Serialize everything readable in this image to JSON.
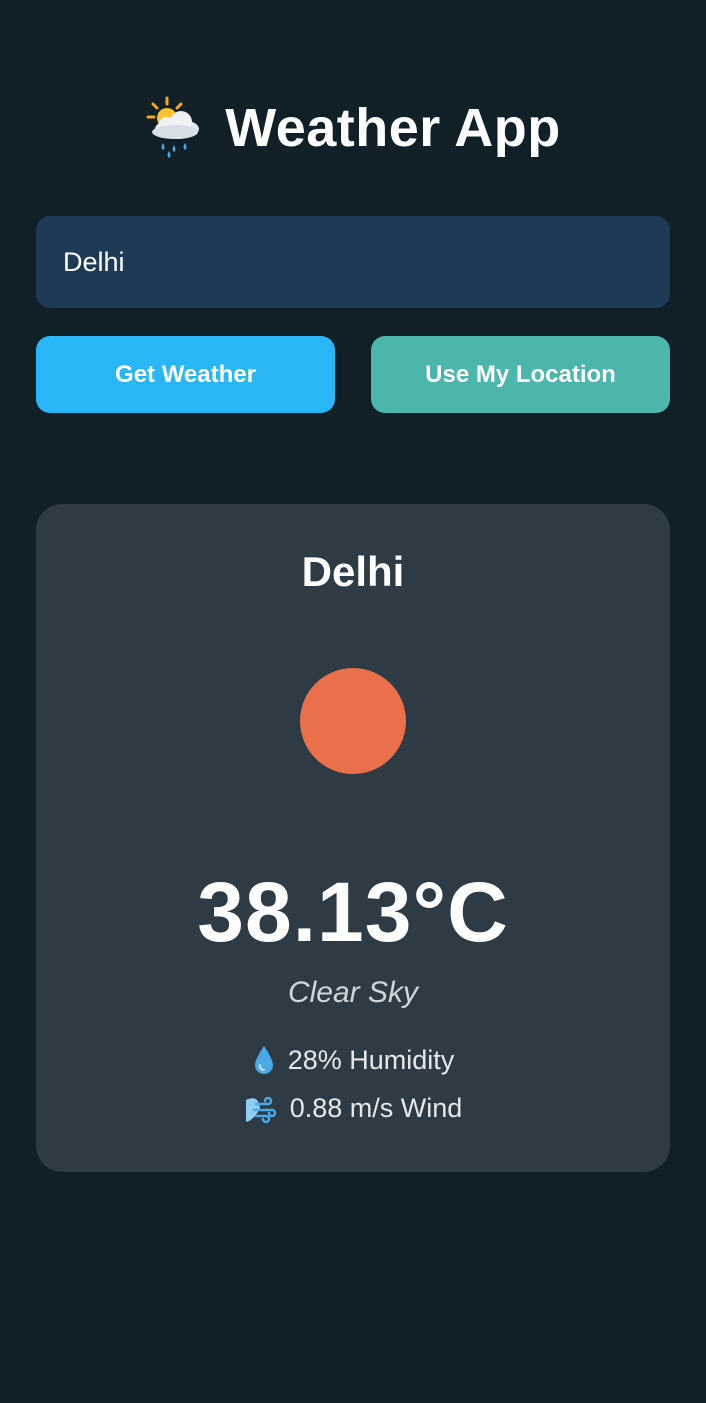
{
  "header": {
    "title": "Weather App",
    "icon": "sun-behind-rain-cloud-icon"
  },
  "search": {
    "value": "Delhi"
  },
  "buttons": {
    "get_weather": "Get Weather",
    "use_location": "Use My Location"
  },
  "weather": {
    "city": "Delhi",
    "icon": "sun-icon",
    "temperature": "38.13°C",
    "description": "Clear Sky",
    "humidity": {
      "icon": "droplet-icon",
      "text": "28% Humidity"
    },
    "wind": {
      "icon": "wind-icon",
      "text": "0.88 m/s Wind"
    }
  },
  "colors": {
    "background": "#111f27",
    "input_bg": "#1f3a57",
    "get_weather_button": "#29b6f6",
    "location_button": "#4db6ac",
    "card_bg": "#2e3b44",
    "sun": "#ea6f4b"
  }
}
